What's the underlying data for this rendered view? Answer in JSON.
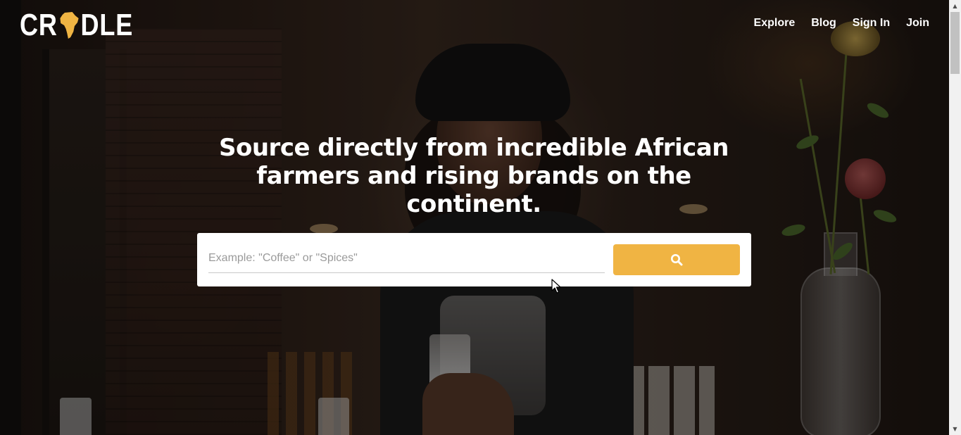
{
  "brand": {
    "logo_left": "CR",
    "logo_right": "DLE",
    "accent_color": "#f0b443"
  },
  "nav": {
    "items": [
      {
        "label": "Explore"
      },
      {
        "label": "Blog"
      },
      {
        "label": "Sign In"
      },
      {
        "label": "Join"
      }
    ]
  },
  "hero": {
    "headline": "Source directly from incredible African farmers and rising brands on the continent.",
    "search": {
      "value": "",
      "placeholder": "Example: \"Coffee\" or \"Spices\"",
      "button_icon": "search-icon",
      "button_color": "#f0b443"
    }
  },
  "scrollbar": {
    "up_arrow": "▲",
    "down_arrow": "▼"
  }
}
